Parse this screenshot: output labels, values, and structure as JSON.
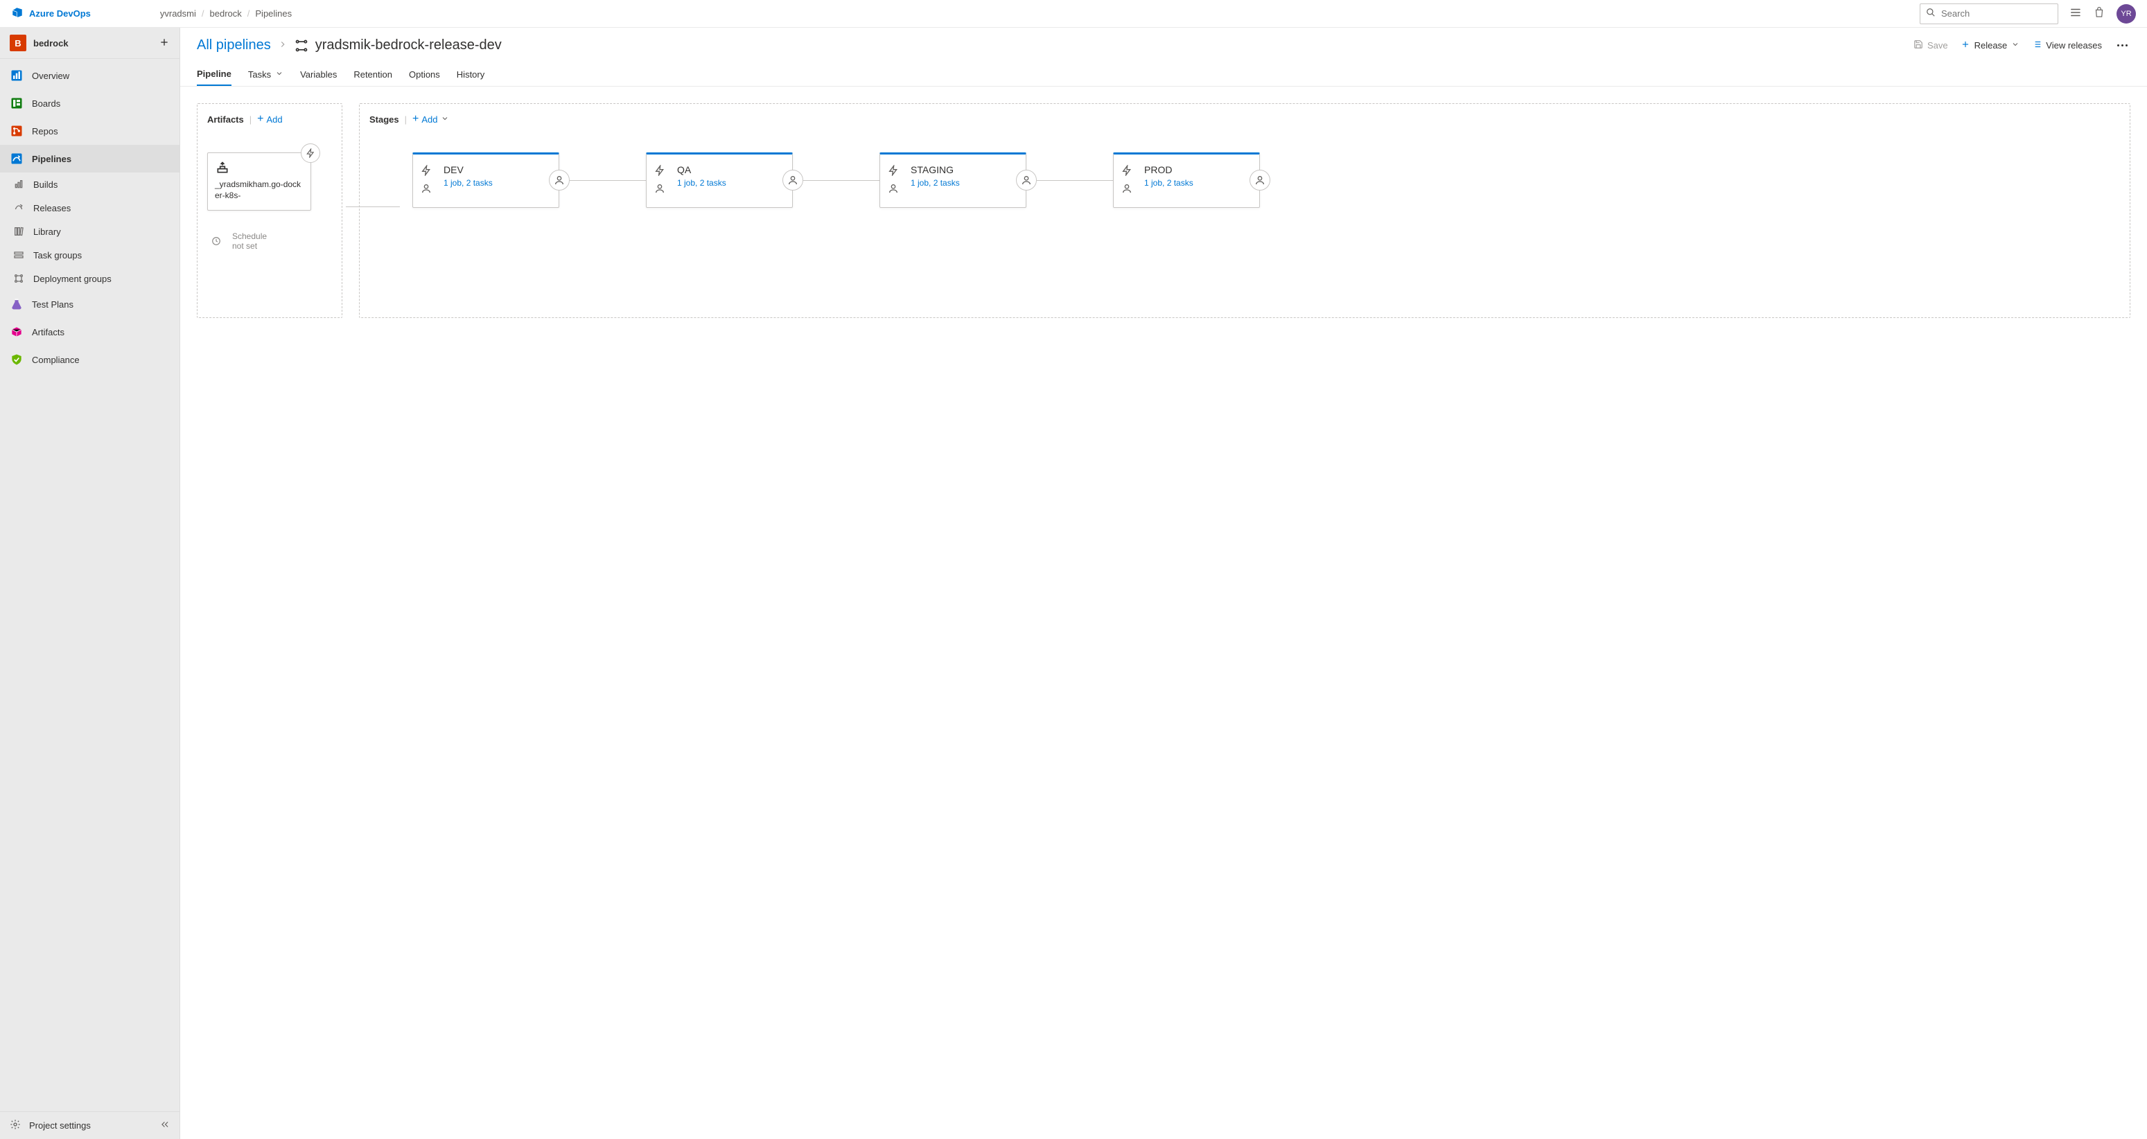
{
  "brand": "Azure DevOps",
  "breadcrumb": [
    "yvradsmi",
    "bedrock",
    "Pipelines"
  ],
  "search": {
    "placeholder": "Search"
  },
  "avatar_initials": "YR",
  "project": {
    "initial": "B",
    "name": "bedrock"
  },
  "sidebar": {
    "items": [
      {
        "label": "Overview"
      },
      {
        "label": "Boards"
      },
      {
        "label": "Repos"
      },
      {
        "label": "Pipelines"
      },
      {
        "label": "Test Plans"
      },
      {
        "label": "Artifacts"
      },
      {
        "label": "Compliance"
      }
    ],
    "pipeline_sub": [
      {
        "label": "Builds"
      },
      {
        "label": "Releases"
      },
      {
        "label": "Library"
      },
      {
        "label": "Task groups"
      },
      {
        "label": "Deployment groups"
      }
    ],
    "footer": "Project settings"
  },
  "header": {
    "all_pipelines": "All pipelines",
    "title": "yradsmik-bedrock-release-dev",
    "save": "Save",
    "release": "Release",
    "view_releases": "View releases"
  },
  "tabs": [
    "Pipeline",
    "Tasks",
    "Variables",
    "Retention",
    "Options",
    "History"
  ],
  "artifacts": {
    "title": "Artifacts",
    "add": "Add",
    "card": "_yradsmikham.go-docker-k8s-",
    "schedule": "Schedule\nnot set"
  },
  "stages": {
    "title": "Stages",
    "add": "Add",
    "items": [
      {
        "name": "DEV",
        "sub": "1 job, 2 tasks"
      },
      {
        "name": "QA",
        "sub": "1 job, 2 tasks"
      },
      {
        "name": "STAGING",
        "sub": "1 job, 2 tasks"
      },
      {
        "name": "PROD",
        "sub": "1 job, 2 tasks"
      }
    ]
  }
}
